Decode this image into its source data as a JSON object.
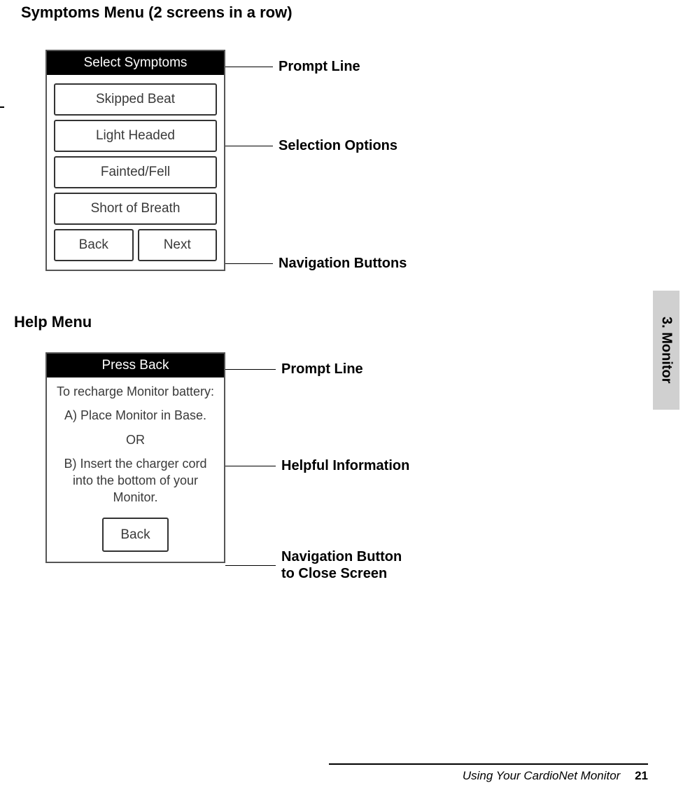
{
  "headings": {
    "symptoms": "Symptoms  Menu (2 screens in a row)",
    "help": "Help  Menu"
  },
  "symptoms_screen": {
    "prompt": "Select Symptoms",
    "options": [
      "Skipped Beat",
      "Light Headed",
      "Fainted/Fell",
      "Short of Breath"
    ],
    "nav": {
      "back": "Back",
      "next": "Next"
    }
  },
  "symptoms_labels": {
    "prompt": "Prompt Line",
    "options": "Selection Options",
    "nav": "Navigation Buttons"
  },
  "help_screen": {
    "prompt": "Press Back",
    "line1": "To recharge Monitor battery:",
    "line2": "A) Place Monitor in Base.",
    "or": "OR",
    "line3": "B) Insert the charger cord into the bottom of your Monitor.",
    "back": "Back"
  },
  "help_labels": {
    "prompt": "Prompt Line",
    "info": "Helpful Information",
    "nav": "Navigation Button\nto Close Screen"
  },
  "side_tab": "3. Monitor",
  "footer": {
    "title": "Using Your CardioNet Monitor",
    "page": "21"
  }
}
